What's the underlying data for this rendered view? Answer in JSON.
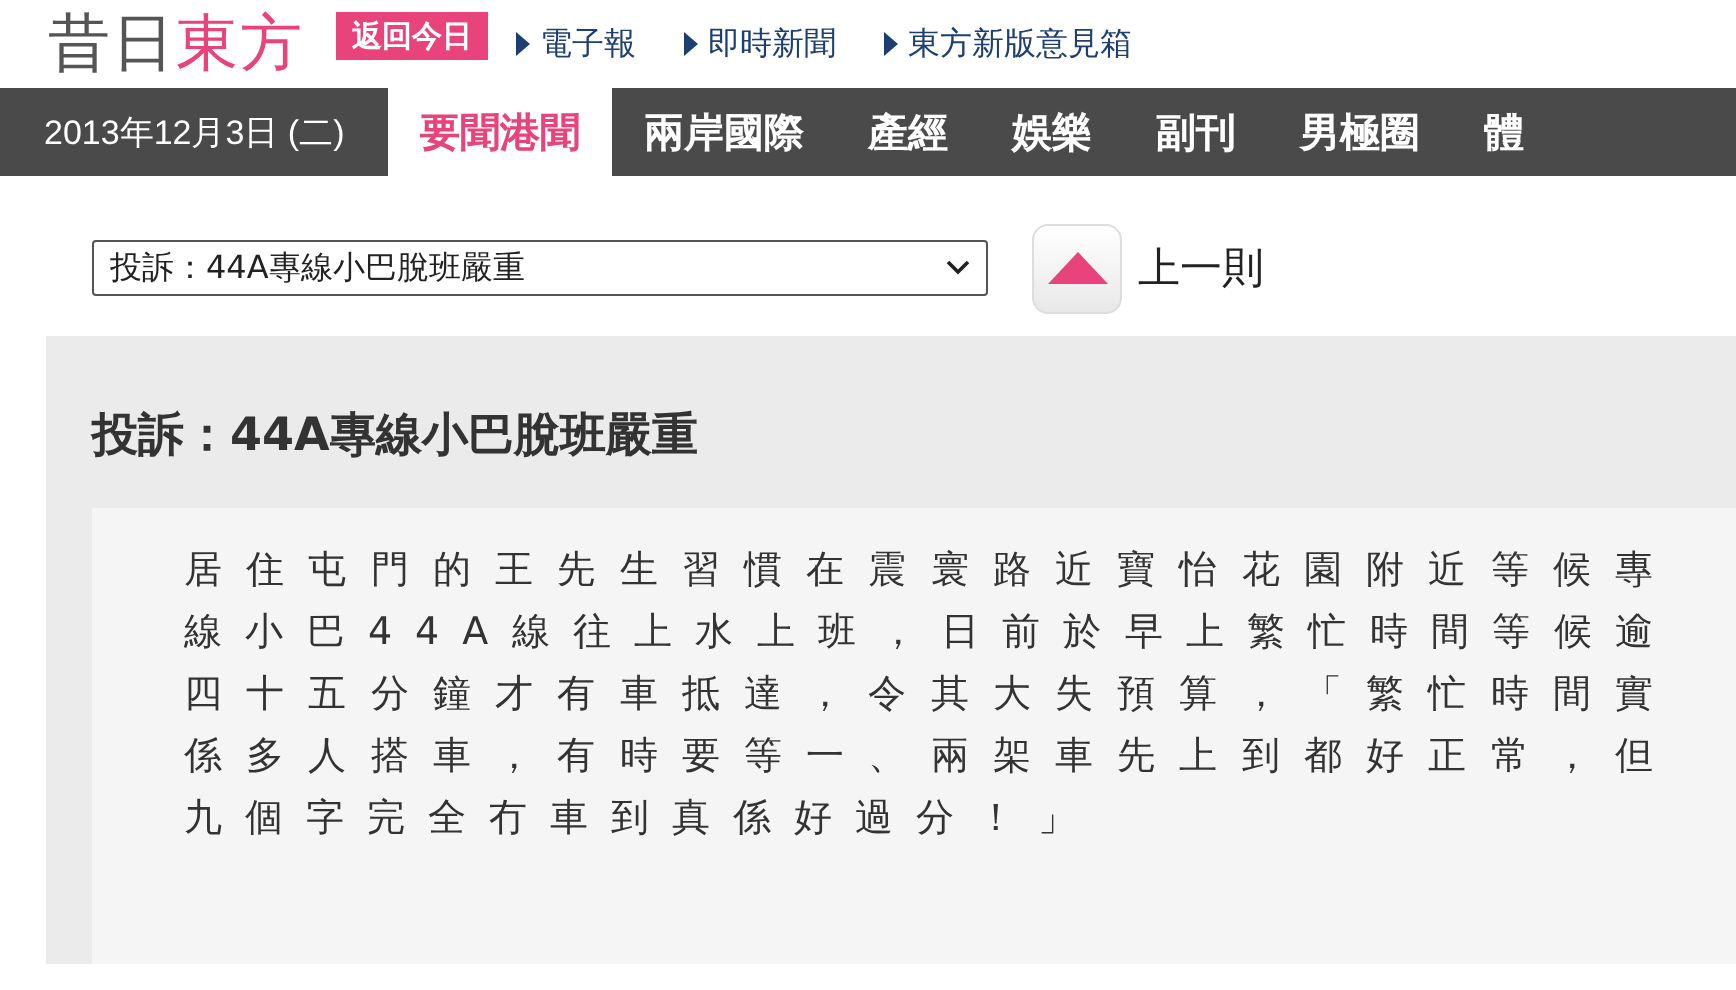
{
  "header": {
    "logo_gray": "昔日",
    "logo_pink": "東方",
    "badge": "返回今日",
    "links": [
      "電子報",
      "即時新聞",
      "東方新版意見箱"
    ]
  },
  "nav": {
    "date": "2013年12月3日 (二)",
    "tabs": [
      {
        "label": "要聞港聞",
        "selected": true
      },
      {
        "label": "兩岸國際",
        "selected": false
      },
      {
        "label": "產經",
        "selected": false
      },
      {
        "label": "娛樂",
        "selected": false
      },
      {
        "label": "副刊",
        "selected": false
      },
      {
        "label": "男極圈",
        "selected": false
      },
      {
        "label": "體",
        "selected": false
      }
    ]
  },
  "article_select": {
    "value": "投訴：44A專線小巴脫班嚴重"
  },
  "prev_button": {
    "label": "上一則"
  },
  "article": {
    "title": "投訴：44A專線小巴脫班嚴重",
    "body": "居住屯門的王先生習慣在震寰路近寶怡花園附近等候專線小巴44A線往上水上班，日前於早上繁忙時間等候逾四十五分鐘才有車抵達，令其大失預算，「繁忙時間實係多人搭車，有時要等一、兩架車先上到都好正常，但九個字完全冇車到真係好過分！」"
  }
}
